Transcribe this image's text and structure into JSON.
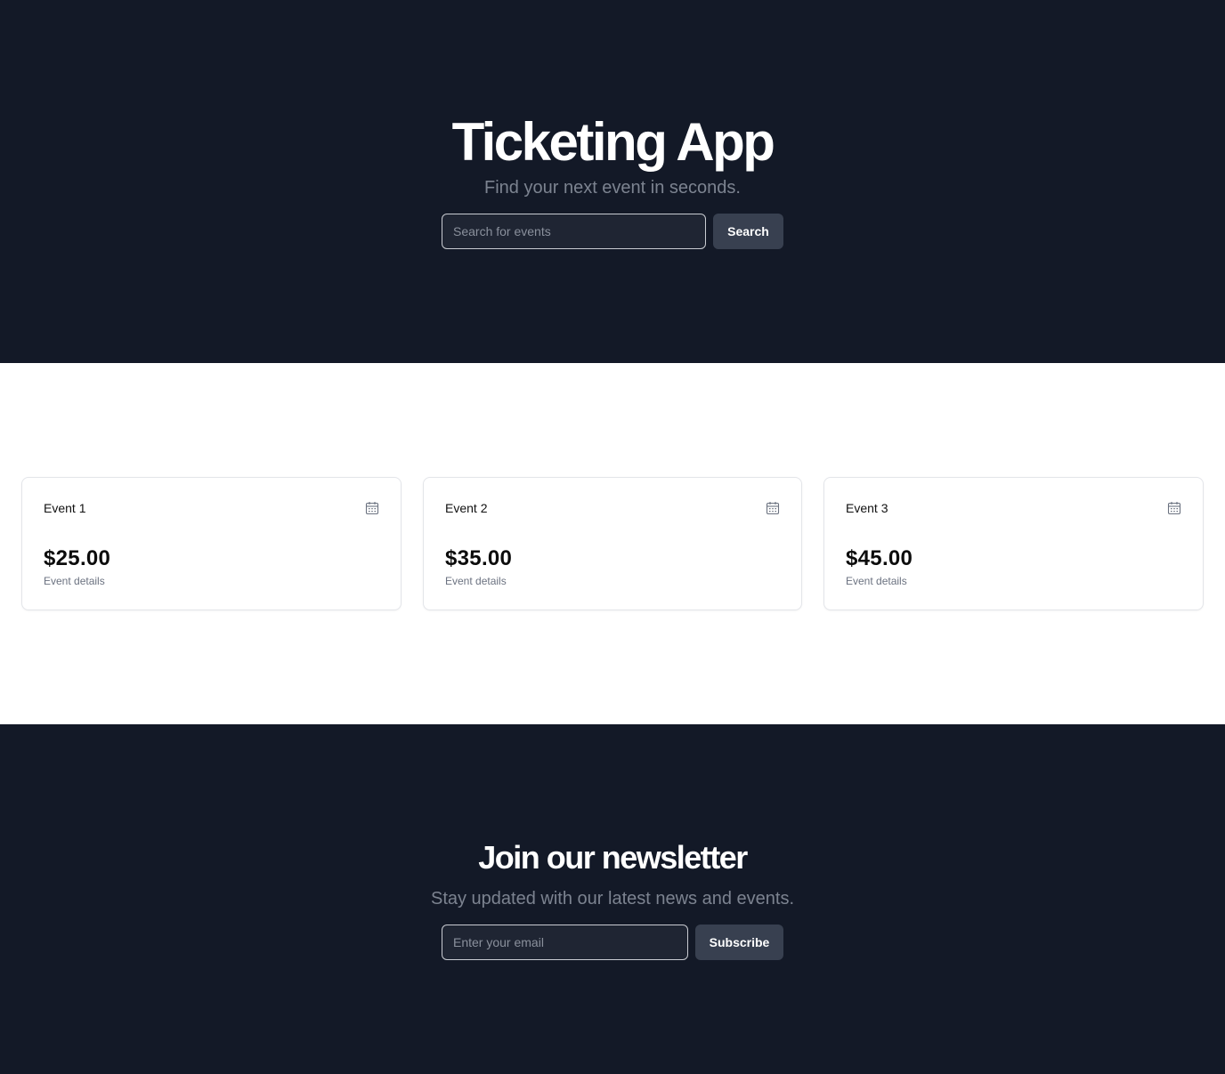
{
  "hero": {
    "title": "Ticketing App",
    "subtitle": "Find your next event in seconds.",
    "search_placeholder": "Search for events",
    "search_value": "",
    "search_button": "Search"
  },
  "events": [
    {
      "name": "Event 1",
      "price": "$25.00",
      "details": "Event details",
      "icon": "calendar-icon"
    },
    {
      "name": "Event 2",
      "price": "$35.00",
      "details": "Event details",
      "icon": "calendar-icon"
    },
    {
      "name": "Event 3",
      "price": "$45.00",
      "details": "Event details",
      "icon": "calendar-icon"
    }
  ],
  "newsletter": {
    "title": "Join our newsletter",
    "subtitle": "Stay updated with our latest news and events.",
    "email_placeholder": "Enter your email",
    "email_value": "",
    "subscribe_button": "Subscribe"
  },
  "colors": {
    "dark_bg": "#131927",
    "button_bg": "#384050",
    "input_bg": "#1f2533",
    "muted_text": "#7c8390",
    "card_border": "#e3e5e9"
  }
}
